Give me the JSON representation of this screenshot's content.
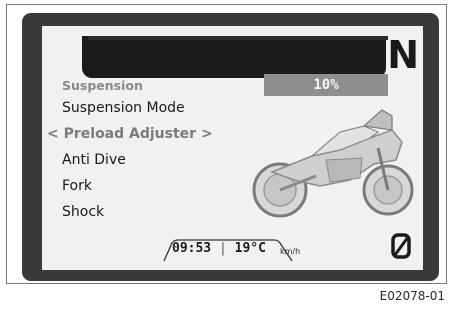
{
  "display": {
    "gear_indicator": "N",
    "menu": {
      "header": "Suspension",
      "items": [
        {
          "label": "Suspension Mode"
        },
        {
          "label": "< Preload Adjuster >"
        },
        {
          "label": "Anti Dive"
        },
        {
          "label": "Fork"
        },
        {
          "label": "Shock"
        }
      ],
      "selected_index": 1
    },
    "value": "10%",
    "status": {
      "time": "09:53",
      "separator": "|",
      "temperature": "19°C",
      "speed_unit": "km/h"
    },
    "icons": {
      "gear_icon": "gear-indicator",
      "mode_icon": "slashed-zero-mode-icon",
      "bike_image": "motorcycle-image"
    }
  },
  "figure": {
    "reference_code": "E02078-01"
  }
}
